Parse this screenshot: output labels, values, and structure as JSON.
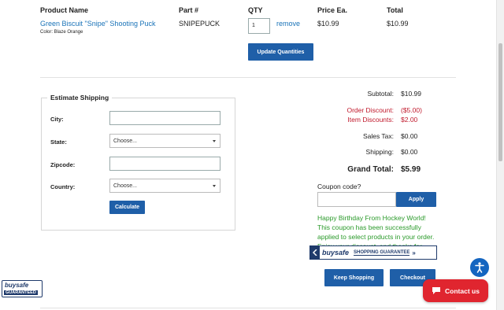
{
  "table": {
    "headers": {
      "product_name": "Product Name",
      "part": "Part #",
      "qty": "QTY",
      "price": "Price Ea.",
      "total": "Total"
    },
    "row": {
      "product_link": "Green Biscuit \"Snipe\" Shooting Puck",
      "color": "Color: Blaze Orange",
      "part": "SNIPEPUCK",
      "qty": "1",
      "remove": "remove",
      "price": "$10.99",
      "total": "$10.99"
    },
    "update_button": "Update Quantities"
  },
  "shipping": {
    "legend": "Estimate Shipping",
    "city_label": "City:",
    "state_label": "State:",
    "state_value": "Choose...",
    "zip_label": "Zipcode:",
    "country_label": "Country:",
    "country_value": "Choose...",
    "calculate_button": "Calculate"
  },
  "summary": {
    "subtotal_label": "Subtotal:",
    "subtotal_value": "$10.99",
    "order_discount_label": "Order Discount:",
    "order_discount_value": "($5.00)",
    "item_discounts_label": "Item Discounts:",
    "item_discounts_value": "$2.00",
    "sales_tax_label": "Sales Tax:",
    "sales_tax_value": "$0.00",
    "shipping_label": "Shipping:",
    "shipping_value": "$0.00",
    "grand_total_label": "Grand Total:",
    "grand_total_value": "$5.99",
    "discount_color": "#c0182b"
  },
  "coupon": {
    "label": "Coupon code?",
    "input_value": "",
    "apply_button": "Apply",
    "message": "Happy Birthday From Hockey World! This coupon has been successfully applied to select products in your order. Enjoy your discount, and thanks for shopping at Hockey World!",
    "message_color": "#2a9a2a"
  },
  "buysafe_badge": {
    "brand": "buysafe",
    "tagline": "SHOPPING GUARANTEE"
  },
  "actions": {
    "keep_shopping": "Keep Shopping",
    "checkout": "Checkout"
  },
  "footer_badge": {
    "brand": "buysafe",
    "tagline": "GUARANTEED"
  },
  "contact": {
    "label": "Contact us"
  },
  "colors": {
    "primary_button": "#1f5fa8",
    "link": "#1a73b8",
    "contact_red": "#e0252f",
    "accessibility_blue": "#1465c0"
  },
  "icons": {
    "accessibility": "accessibility-icon",
    "chat": "chat-bubble-icon",
    "buysafe_arrow": "chevron-right-icon"
  }
}
